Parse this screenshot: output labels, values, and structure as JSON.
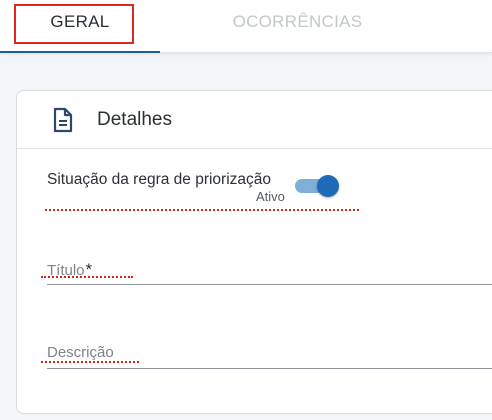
{
  "tabs": [
    {
      "label": "GERAL",
      "active": true
    },
    {
      "label": "OCORRÊNCIAS",
      "active": false
    }
  ],
  "card": {
    "icon": "document-icon",
    "title": "Detalhes"
  },
  "toggle": {
    "label": "Situação da regra de priorização",
    "status": "Ativo",
    "checked": true
  },
  "fields": {
    "titulo": {
      "label": "Título",
      "required_mark": "*",
      "value": ""
    },
    "descricao": {
      "label": "Descrição",
      "value": ""
    }
  },
  "colors": {
    "accent": "#1d6ab8",
    "annotation_red": "#e2261c",
    "inactive_tab_text": "#c2c7ce"
  }
}
